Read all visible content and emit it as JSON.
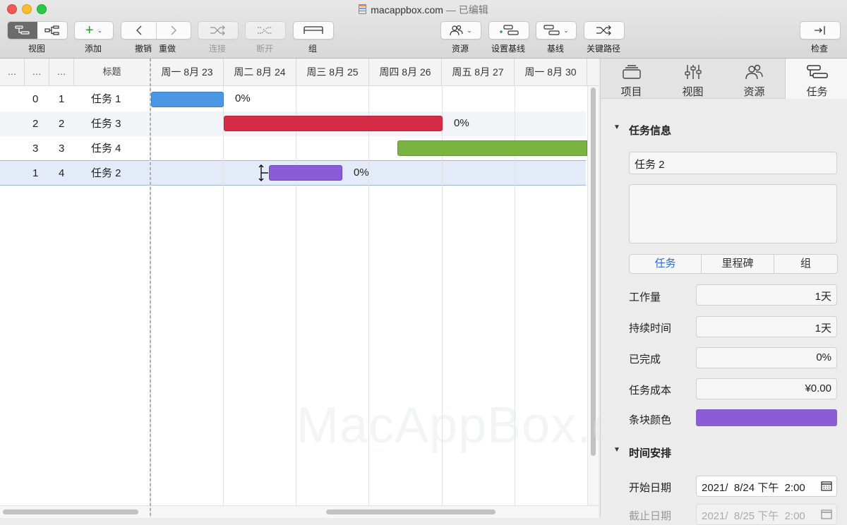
{
  "window": {
    "title": "macappbox.com",
    "status": "— 已编辑"
  },
  "toolbar": {
    "view_label": "视图",
    "add_label": "添加",
    "undo_label": "撤销",
    "redo_label": "重做",
    "connect_label": "连接",
    "disconnect_label": "断开",
    "group_label": "组",
    "resources_label": "资源",
    "set_baseline_label": "设置基线",
    "baseline_label": "基线",
    "critical_path_label": "关键路径",
    "inspect_label": "检查"
  },
  "table": {
    "headers": [
      "…",
      "…",
      "…",
      "标题"
    ],
    "rows": [
      {
        "c1": "0",
        "c2": "1",
        "title": "任务 1"
      },
      {
        "c1": "2",
        "c2": "2",
        "title": "任务 3"
      },
      {
        "c1": "3",
        "c2": "3",
        "title": "任务 4"
      },
      {
        "c1": "1",
        "c2": "4",
        "title": "任务 2"
      }
    ]
  },
  "gantt": {
    "dates": [
      "周一 8月 23",
      "周二 8月 24",
      "周三 8月 25",
      "周四 8月 26",
      "周五 8月 27",
      "周一 8月 30"
    ],
    "bars": [
      {
        "name": "任务 1",
        "color": "#4c97e3",
        "percent": "0%"
      },
      {
        "name": "任务 3",
        "color": "#d52b45",
        "percent": "0%"
      },
      {
        "name": "任务 4",
        "color": "#79b441",
        "percent": ""
      },
      {
        "name": "任务 2",
        "color": "#8a5cd6",
        "percent": "0%"
      }
    ]
  },
  "inspector": {
    "tabs": [
      "项目",
      "视图",
      "资源",
      "任务"
    ],
    "task_info_heading": "任务信息",
    "task_name_value": "任务 2",
    "segments": [
      "任务",
      "里程碑",
      "组"
    ],
    "fields": [
      {
        "label": "工作量",
        "value": "1天"
      },
      {
        "label": "持续时间",
        "value": "1天"
      },
      {
        "label": "已完成",
        "value": "0%"
      },
      {
        "label": "任务成本",
        "value": "¥0.00"
      }
    ],
    "bar_color_label": "条块颜色",
    "bar_color": "#8a5cd6",
    "schedule_heading": "时间安排",
    "start_label": "开始日期",
    "start_value": "2021/  8/24 下午  2:00",
    "end_label": "截止日期",
    "end_value": "2021/  8/25 下午  2:00"
  },
  "watermark": "MacAppBox.com"
}
